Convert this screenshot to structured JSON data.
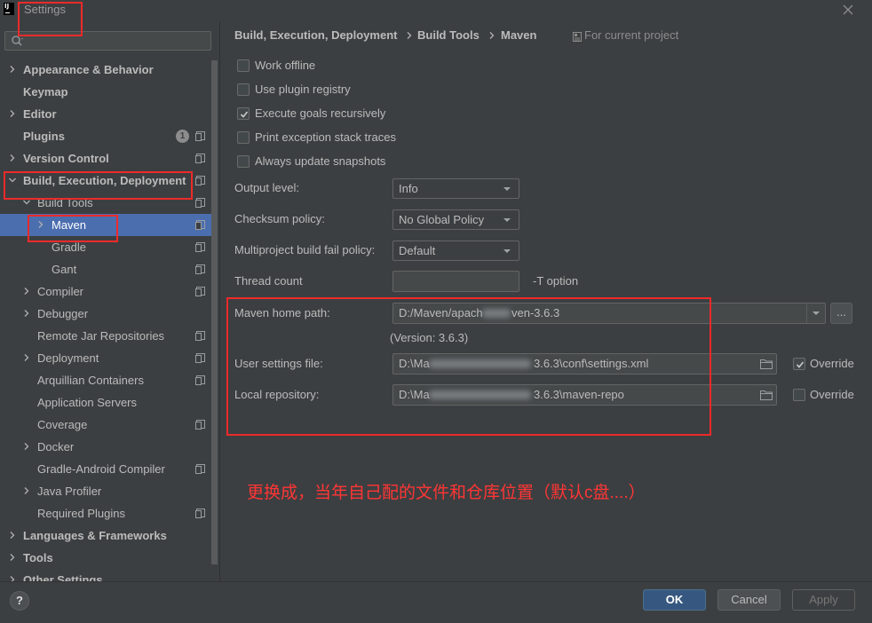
{
  "window": {
    "title": "Settings",
    "logo_text": "IJ",
    "help_label": "?"
  },
  "colors": {
    "selection": "#4b6eaf",
    "primary_button": "#365880",
    "annotation": "#ee2a2a"
  },
  "sidebar": {
    "search": {
      "value": ""
    },
    "tree": [
      {
        "label": "Appearance & Behavior",
        "level": 0,
        "expandable": true,
        "expanded": false,
        "bold": true,
        "project_icon": false
      },
      {
        "label": "Keymap",
        "level": 0,
        "expandable": false,
        "bold": true,
        "project_icon": false
      },
      {
        "label": "Editor",
        "level": 0,
        "expandable": true,
        "expanded": false,
        "bold": true,
        "project_icon": false
      },
      {
        "label": "Plugins",
        "level": 0,
        "expandable": false,
        "bold": true,
        "badge": "1",
        "project_icon": true
      },
      {
        "label": "Version Control",
        "level": 0,
        "expandable": true,
        "expanded": false,
        "bold": true,
        "project_icon": true
      },
      {
        "label": "Build, Execution, Deployment",
        "level": 0,
        "expandable": true,
        "expanded": true,
        "bold": true,
        "project_icon": true
      },
      {
        "label": "Build Tools",
        "level": 1,
        "expandable": true,
        "expanded": true,
        "bold": false,
        "project_icon": true
      },
      {
        "label": "Maven",
        "level": 2,
        "expandable": true,
        "expanded": false,
        "bold": false,
        "selected": true,
        "project_icon": true
      },
      {
        "label": "Gradle",
        "level": 2,
        "expandable": false,
        "bold": false,
        "project_icon": true
      },
      {
        "label": "Gant",
        "level": 2,
        "expandable": false,
        "bold": false,
        "project_icon": true
      },
      {
        "label": "Compiler",
        "level": 1,
        "expandable": true,
        "expanded": false,
        "bold": false,
        "project_icon": true
      },
      {
        "label": "Debugger",
        "level": 1,
        "expandable": true,
        "expanded": false,
        "bold": false,
        "project_icon": false
      },
      {
        "label": "Remote Jar Repositories",
        "level": 1,
        "expandable": false,
        "bold": false,
        "project_icon": true
      },
      {
        "label": "Deployment",
        "level": 1,
        "expandable": true,
        "expanded": false,
        "bold": false,
        "project_icon": true
      },
      {
        "label": "Arquillian Containers",
        "level": 1,
        "expandable": false,
        "bold": false,
        "project_icon": true
      },
      {
        "label": "Application Servers",
        "level": 1,
        "expandable": false,
        "bold": false,
        "project_icon": false
      },
      {
        "label": "Coverage",
        "level": 1,
        "expandable": false,
        "bold": false,
        "project_icon": true
      },
      {
        "label": "Docker",
        "level": 1,
        "expandable": true,
        "expanded": false,
        "bold": false,
        "project_icon": false
      },
      {
        "label": "Gradle-Android Compiler",
        "level": 1,
        "expandable": false,
        "bold": false,
        "project_icon": true
      },
      {
        "label": "Java Profiler",
        "level": 1,
        "expandable": true,
        "expanded": false,
        "bold": false,
        "project_icon": false
      },
      {
        "label": "Required Plugins",
        "level": 1,
        "expandable": false,
        "bold": false,
        "project_icon": true
      },
      {
        "label": "Languages & Frameworks",
        "level": 0,
        "expandable": true,
        "expanded": false,
        "bold": true,
        "project_icon": false
      },
      {
        "label": "Tools",
        "level": 0,
        "expandable": true,
        "expanded": false,
        "bold": true,
        "project_icon": false
      },
      {
        "label": "Other Settings",
        "level": 0,
        "expandable": true,
        "expanded": false,
        "bold": true,
        "project_icon": false
      }
    ]
  },
  "breadcrumb": {
    "items": [
      "Build, Execution, Deployment",
      "Build Tools",
      "Maven"
    ],
    "scope": "For current project"
  },
  "options": {
    "checkboxes": [
      {
        "label": "Work offline",
        "checked": false
      },
      {
        "label": "Use plugin registry",
        "checked": false
      },
      {
        "label": "Execute goals recursively",
        "checked": true
      },
      {
        "label": "Print exception stack traces",
        "checked": false
      },
      {
        "label": "Always update snapshots",
        "checked": false
      }
    ],
    "output_level": {
      "label": "Output level:",
      "value": "Info"
    },
    "checksum_policy": {
      "label": "Checksum policy:",
      "value": "No Global Policy"
    },
    "fail_policy": {
      "label": "Multiproject build fail policy:",
      "value": "Default"
    },
    "thread_count": {
      "label": "Thread count",
      "value": "",
      "hint": "-T option"
    },
    "maven_home": {
      "label": "Maven home path:",
      "value_visible_start": "D:/Maven/apach",
      "value_visible_end": "ven-3.6.3",
      "browse_label": "...",
      "version": "(Version: 3.6.3)"
    },
    "user_settings": {
      "label": "User settings file:",
      "value_visible_start": "D:\\Ma",
      "value_visible_end": "3.6.3\\conf\\settings.xml",
      "override_label": "Override",
      "override_checked": true
    },
    "local_repository": {
      "label": "Local repository:",
      "value_visible_start": "D:\\Ma",
      "value_visible_end": "3.6.3\\maven-repo",
      "override_label": "Override",
      "override_checked": false
    }
  },
  "buttons": {
    "ok": "OK",
    "cancel": "Cancel",
    "apply": "Apply",
    "apply_enabled": false
  },
  "annotation": {
    "note": "更换成，当年自己配的文件和仓库位置（默认c盘....）"
  }
}
